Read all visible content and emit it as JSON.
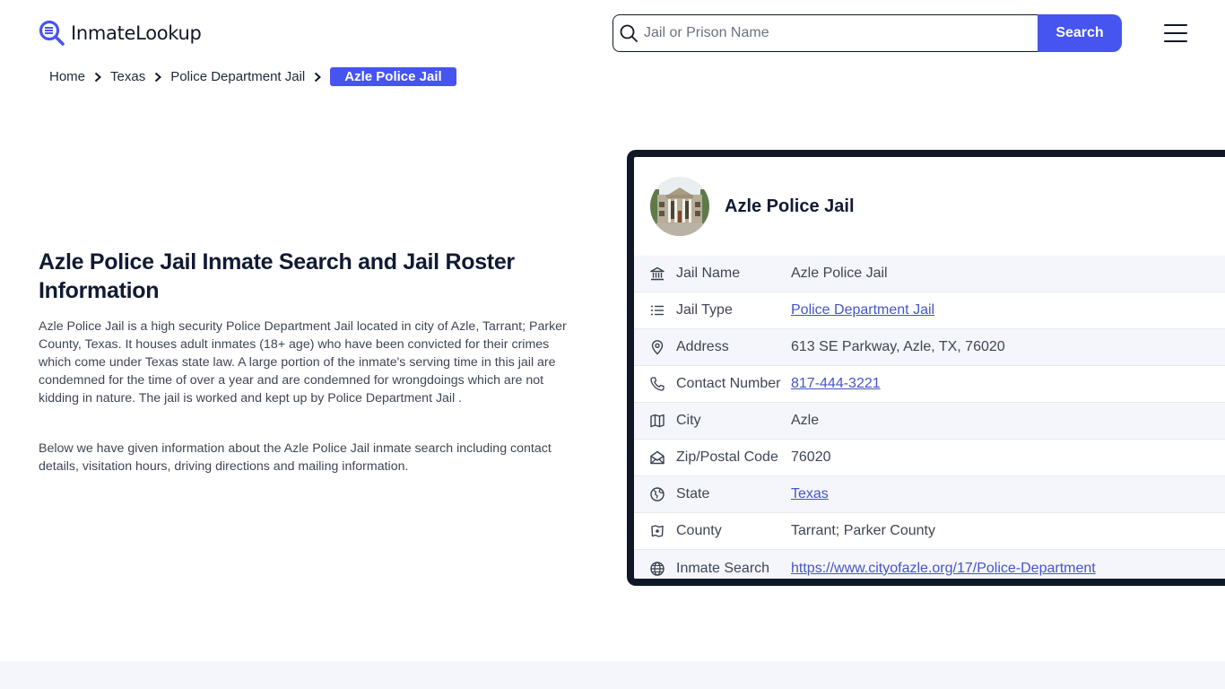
{
  "header": {
    "logo_text": "InmateLookup",
    "search_placeholder": "Jail or Prison Name",
    "search_value": "",
    "search_button": "Search",
    "menu_icon": "hamburger-menu-icon"
  },
  "breadcrumb": {
    "items": [
      "Home",
      "Texas",
      "Police Department Jail"
    ],
    "current": "Azle Police Jail",
    "separator_icon": "chevron-right-icon"
  },
  "main": {
    "title": "Azle Police Jail Inmate Search and Jail Roster Information",
    "paragraphs": [
      "Azle Police Jail is a high security Police Department Jail located in city of Azle, Tarrant; Parker County, Texas. It houses adult inmates (18+ age) who have been convicted for their crimes which come under Texas state law. A large portion of the inmate's serving time in this jail are condemned for the time of over a year and are condemned for wrongdoings which are not kidding in nature. The jail is worked and kept up by Police Department Jail .",
      "Below we have given information about the Azle Police Jail inmate search including contact details, visitation hours, driving directions and mailing information."
    ]
  },
  "card": {
    "title": "Azle Police Jail",
    "avatar_alt": "courthouse-building-photo",
    "rows": [
      {
        "icon": "bank-building-icon",
        "label": "Jail Name",
        "value": "Azle Police Jail",
        "link": false
      },
      {
        "icon": "list-icon",
        "label": "Jail Type",
        "value": "Police Department Jail",
        "link": true
      },
      {
        "icon": "map-pin-icon",
        "label": "Address",
        "value": "613 SE Parkway, Azle, TX, 76020",
        "link": false
      },
      {
        "icon": "phone-icon",
        "label": "Contact Number",
        "value": "817-444-3221",
        "link": true
      },
      {
        "icon": "map-icon",
        "label": "City",
        "value": "Azle",
        "link": false
      },
      {
        "icon": "mail-open-icon",
        "label": "Zip/Postal Code",
        "value": "76020",
        "link": false
      },
      {
        "icon": "globe-region-icon",
        "label": "State",
        "value": "Texas",
        "link": true
      },
      {
        "icon": "county-map-icon",
        "label": "County",
        "value": "Tarrant; Parker County",
        "link": false
      },
      {
        "icon": "globe-icon",
        "label": "Inmate Search",
        "value": "https://www.cityofazle.org/17/Police-Department",
        "link": true
      }
    ]
  },
  "colors": {
    "accent": "#4654f0",
    "link": "#4654c8",
    "card_border": "#101828",
    "row_alt": "#f5f6fb",
    "heading": "#111a33"
  }
}
